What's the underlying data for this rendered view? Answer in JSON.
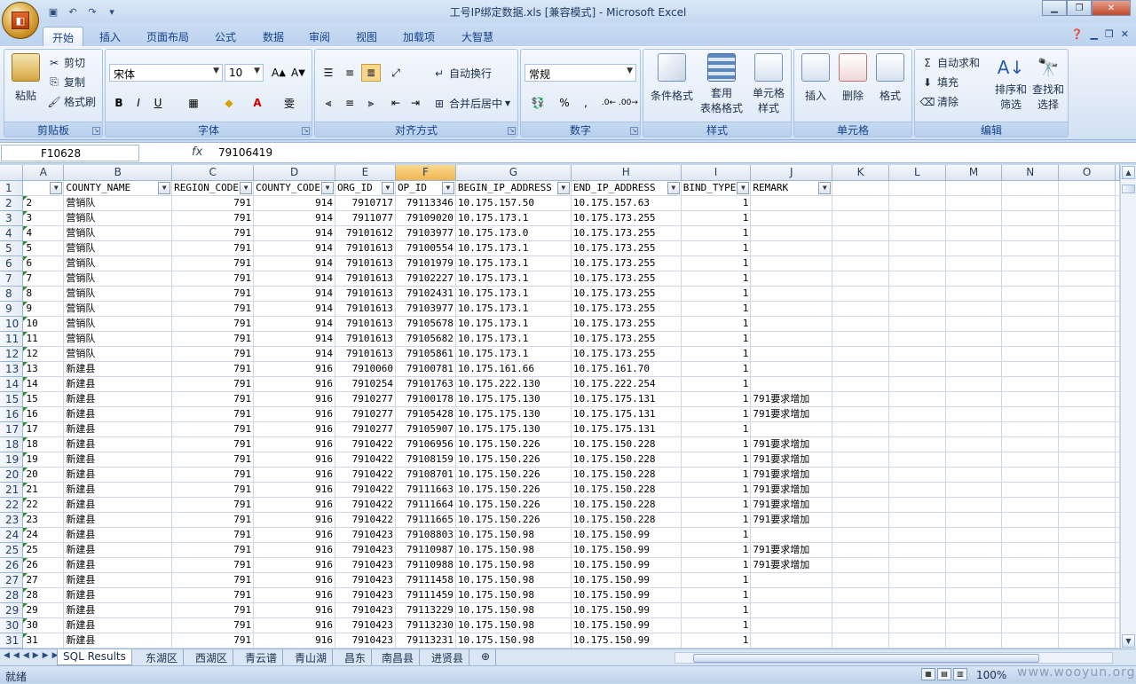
{
  "window": {
    "title": "工号IP绑定数据.xls  [兼容模式] - Microsoft Excel"
  },
  "ribbon_tabs": [
    "开始",
    "插入",
    "页面布局",
    "公式",
    "数据",
    "审阅",
    "视图",
    "加载项",
    "大智慧"
  ],
  "clipboard": {
    "paste": "粘贴",
    "cut": "剪切",
    "copy": "复制",
    "format_painter": "格式刷",
    "label": "剪贴板"
  },
  "font": {
    "name": "宋体",
    "size": "10",
    "label": "字体"
  },
  "alignment": {
    "wrap": "自动换行",
    "merge": "合并后居中",
    "label": "对齐方式"
  },
  "number": {
    "format": "常规",
    "label": "数字"
  },
  "styles": {
    "cond": "条件格式",
    "table1": "套用",
    "table2": "表格格式",
    "cell1": "单元格",
    "cell2": "样式",
    "label": "样式"
  },
  "cells": {
    "insert": "插入",
    "delete": "删除",
    "format": "格式",
    "label": "单元格"
  },
  "editing": {
    "autosum": "自动求和",
    "fill": "填充",
    "clear": "清除",
    "sort1": "排序和",
    "sort2": "筛选",
    "find1": "查找和",
    "find2": "选择",
    "label": "编辑"
  },
  "formula_bar": {
    "name_box": "F10628",
    "fx": "fx",
    "value": "79106419"
  },
  "columns": [
    "A",
    "B",
    "C",
    "D",
    "E",
    "F",
    "G",
    "H",
    "I",
    "J",
    "K",
    "L",
    "M",
    "N",
    "O"
  ],
  "headers": [
    "",
    "COUNTY_NAME",
    "REGION_CODE",
    "COUNTY_CODE",
    "ORG_ID",
    "OP_ID",
    "BEGIN_IP_ADDRESS",
    "END_IP_ADDRESS",
    "BIND_TYPE",
    "REMARK"
  ],
  "rows": [
    [
      "2",
      "营销队",
      "791",
      "914",
      "7910717",
      "79113346",
      "10.175.157.50",
      "10.175.157.63",
      "1",
      ""
    ],
    [
      "3",
      "营销队",
      "791",
      "914",
      "7911077",
      "79109020",
      "10.175.173.1",
      "10.175.173.255",
      "1",
      ""
    ],
    [
      "4",
      "营销队",
      "791",
      "914",
      "79101612",
      "79103977",
      "10.175.173.0",
      "10.175.173.255",
      "1",
      ""
    ],
    [
      "5",
      "营销队",
      "791",
      "914",
      "79101613",
      "79100554",
      "10.175.173.1",
      "10.175.173.255",
      "1",
      ""
    ],
    [
      "6",
      "营销队",
      "791",
      "914",
      "79101613",
      "79101979",
      "10.175.173.1",
      "10.175.173.255",
      "1",
      ""
    ],
    [
      "7",
      "营销队",
      "791",
      "914",
      "79101613",
      "79102227",
      "10.175.173.1",
      "10.175.173.255",
      "1",
      ""
    ],
    [
      "8",
      "营销队",
      "791",
      "914",
      "79101613",
      "79102431",
      "10.175.173.1",
      "10.175.173.255",
      "1",
      ""
    ],
    [
      "9",
      "营销队",
      "791",
      "914",
      "79101613",
      "79103977",
      "10.175.173.1",
      "10.175.173.255",
      "1",
      ""
    ],
    [
      "10",
      "营销队",
      "791",
      "914",
      "79101613",
      "79105678",
      "10.175.173.1",
      "10.175.173.255",
      "1",
      ""
    ],
    [
      "11",
      "营销队",
      "791",
      "914",
      "79101613",
      "79105682",
      "10.175.173.1",
      "10.175.173.255",
      "1",
      ""
    ],
    [
      "12",
      "营销队",
      "791",
      "914",
      "79101613",
      "79105861",
      "10.175.173.1",
      "10.175.173.255",
      "1",
      ""
    ],
    [
      "13",
      "新建县",
      "791",
      "916",
      "7910060",
      "79100781",
      "10.175.161.66",
      "10.175.161.70",
      "1",
      ""
    ],
    [
      "14",
      "新建县",
      "791",
      "916",
      "7910254",
      "79101763",
      "10.175.222.130",
      "10.175.222.254",
      "1",
      ""
    ],
    [
      "15",
      "新建县",
      "791",
      "916",
      "7910277",
      "79100178",
      "10.175.175.130",
      "10.175.175.131",
      "1",
      "791要求增加"
    ],
    [
      "16",
      "新建县",
      "791",
      "916",
      "7910277",
      "79105428",
      "10.175.175.130",
      "10.175.175.131",
      "1",
      "791要求增加"
    ],
    [
      "17",
      "新建县",
      "791",
      "916",
      "7910277",
      "79105907",
      "10.175.175.130",
      "10.175.175.131",
      "1",
      ""
    ],
    [
      "18",
      "新建县",
      "791",
      "916",
      "7910422",
      "79106956",
      "10.175.150.226",
      "10.175.150.228",
      "1",
      "791要求增加"
    ],
    [
      "19",
      "新建县",
      "791",
      "916",
      "7910422",
      "79108159",
      "10.175.150.226",
      "10.175.150.228",
      "1",
      "791要求增加"
    ],
    [
      "20",
      "新建县",
      "791",
      "916",
      "7910422",
      "79108701",
      "10.175.150.226",
      "10.175.150.228",
      "1",
      "791要求增加"
    ],
    [
      "21",
      "新建县",
      "791",
      "916",
      "7910422",
      "79111663",
      "10.175.150.226",
      "10.175.150.228",
      "1",
      "791要求增加"
    ],
    [
      "22",
      "新建县",
      "791",
      "916",
      "7910422",
      "79111664",
      "10.175.150.226",
      "10.175.150.228",
      "1",
      "791要求增加"
    ],
    [
      "23",
      "新建县",
      "791",
      "916",
      "7910422",
      "79111665",
      "10.175.150.226",
      "10.175.150.228",
      "1",
      "791要求增加"
    ],
    [
      "24",
      "新建县",
      "791",
      "916",
      "7910423",
      "79108803",
      "10.175.150.98",
      "10.175.150.99",
      "1",
      ""
    ],
    [
      "25",
      "新建县",
      "791",
      "916",
      "7910423",
      "79110987",
      "10.175.150.98",
      "10.175.150.99",
      "1",
      "791要求增加"
    ],
    [
      "26",
      "新建县",
      "791",
      "916",
      "7910423",
      "79110988",
      "10.175.150.98",
      "10.175.150.99",
      "1",
      "791要求增加"
    ],
    [
      "27",
      "新建县",
      "791",
      "916",
      "7910423",
      "79111458",
      "10.175.150.98",
      "10.175.150.99",
      "1",
      ""
    ],
    [
      "28",
      "新建县",
      "791",
      "916",
      "7910423",
      "79111459",
      "10.175.150.98",
      "10.175.150.99",
      "1",
      ""
    ],
    [
      "29",
      "新建县",
      "791",
      "916",
      "7910423",
      "79113229",
      "10.175.150.98",
      "10.175.150.99",
      "1",
      ""
    ],
    [
      "30",
      "新建县",
      "791",
      "916",
      "7910423",
      "79113230",
      "10.175.150.98",
      "10.175.150.99",
      "1",
      ""
    ],
    [
      "31",
      "新建县",
      "791",
      "916",
      "7910423",
      "79113231",
      "10.175.150.98",
      "10.175.150.99",
      "1",
      ""
    ]
  ],
  "sheet_tabs": [
    "SQL Results",
    "东湖区",
    "西湖区",
    "青云谱",
    "青山湖",
    "昌东",
    "南昌县",
    "进贤县"
  ],
  "status": {
    "ready": "就绪",
    "zoom": "100%"
  },
  "watermark": "www.wooyun.org"
}
